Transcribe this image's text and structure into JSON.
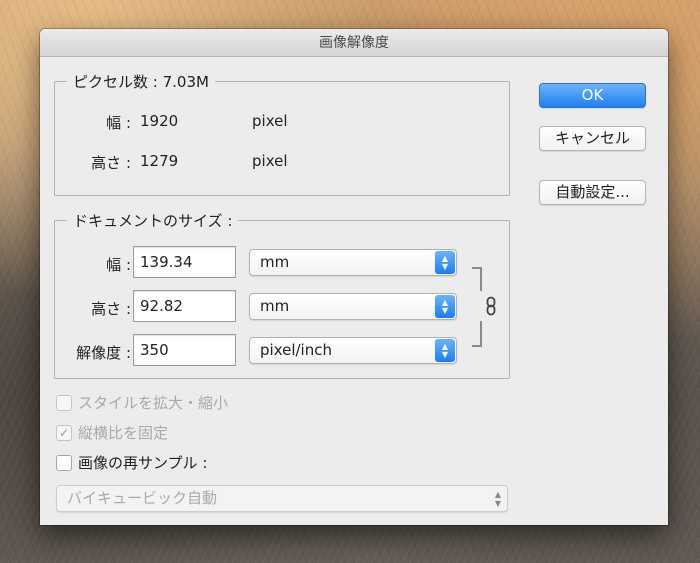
{
  "window": {
    "title": "画像解像度"
  },
  "pixel_dimensions": {
    "legend": "ピクセル数 : 7.03M",
    "width_label": "幅 :",
    "width_value": "1920",
    "width_unit": "pixel",
    "height_label": "高さ :",
    "height_value": "1279",
    "height_unit": "pixel"
  },
  "document_size": {
    "legend": "ドキュメントのサイズ :",
    "width_label": "幅 :",
    "width_value": "139.34",
    "width_unit": "mm",
    "height_label": "高さ :",
    "height_value": "92.82",
    "height_unit": "mm",
    "resolution_label": "解像度 :",
    "resolution_value": "350",
    "resolution_unit": "pixel/inch",
    "link_icon": "chain-link-icon"
  },
  "options": {
    "scale_styles": {
      "label": "スタイルを拡大・縮小",
      "checked": false,
      "enabled": false
    },
    "constrain_proportions": {
      "label": "縦横比を固定",
      "checked": true,
      "enabled": false
    },
    "resample": {
      "label": "画像の再サンプル :",
      "checked": false,
      "enabled": true
    },
    "resample_method": {
      "value": "バイキュービック自動",
      "enabled": false
    }
  },
  "buttons": {
    "ok": "OK",
    "cancel": "キャンセル",
    "auto": "自動設定..."
  },
  "colors": {
    "accent": "#1f7ff1",
    "dialog_bg": "#ececec"
  }
}
